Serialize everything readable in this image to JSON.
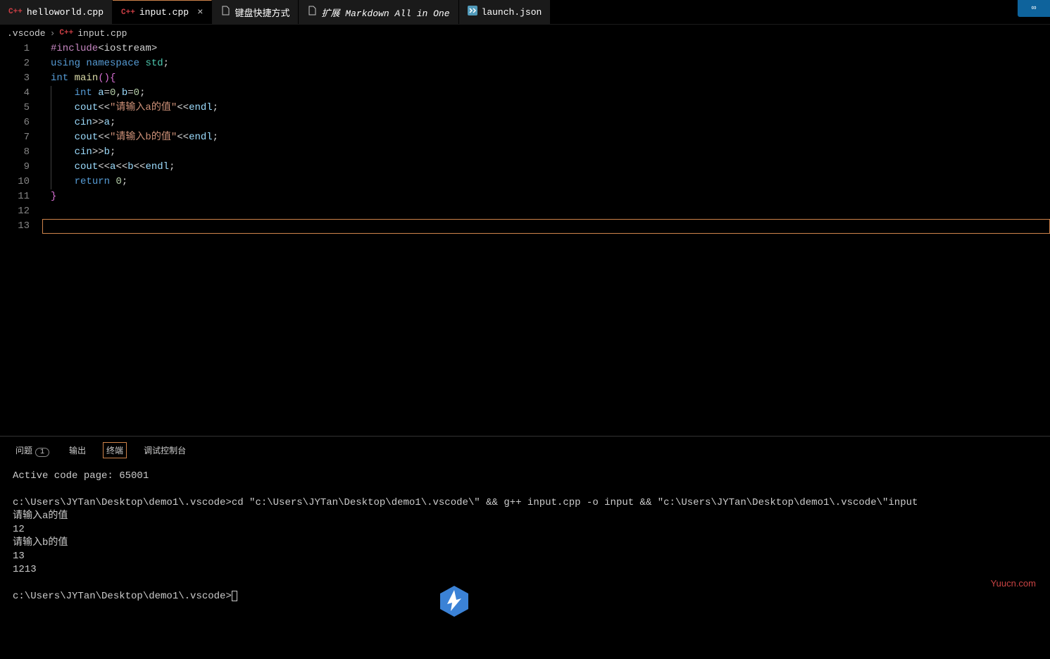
{
  "tabs": [
    {
      "label": "helloworld.cpp",
      "icon": "cpp",
      "active": false,
      "italic": false
    },
    {
      "label": "input.cpp",
      "icon": "cpp",
      "active": true,
      "italic": false,
      "closeable": true
    },
    {
      "label": "键盘快捷方式",
      "icon": "file",
      "active": false,
      "italic": false
    },
    {
      "label": "扩展 Markdown All in One",
      "icon": "file",
      "active": false,
      "italic": true
    },
    {
      "label": "launch.json",
      "icon": "json",
      "active": false,
      "italic": false
    }
  ],
  "breadcrumb": {
    "parts": [
      ".vscode",
      "input.cpp"
    ],
    "icon_label": "C++"
  },
  "code": {
    "lines": [
      [
        {
          "t": "preproc",
          "v": "#include"
        },
        {
          "t": "default",
          "v": "<iostream>"
        }
      ],
      [
        {
          "t": "keyword",
          "v": "using"
        },
        {
          "t": "default",
          "v": " "
        },
        {
          "t": "keyword",
          "v": "namespace"
        },
        {
          "t": "default",
          "v": " "
        },
        {
          "t": "namespace",
          "v": "std"
        },
        {
          "t": "default",
          "v": ";"
        }
      ],
      [
        {
          "t": "type",
          "v": "int"
        },
        {
          "t": "default",
          "v": " "
        },
        {
          "t": "func",
          "v": "main"
        },
        {
          "t": "brace",
          "v": "()"
        },
        {
          "t": "brace",
          "v": "{"
        }
      ],
      [
        {
          "t": "default",
          "v": "    "
        },
        {
          "t": "type",
          "v": "int"
        },
        {
          "t": "default",
          "v": " "
        },
        {
          "t": "ident",
          "v": "a"
        },
        {
          "t": "default",
          "v": "="
        },
        {
          "t": "number",
          "v": "0"
        },
        {
          "t": "default",
          "v": ","
        },
        {
          "t": "ident",
          "v": "b"
        },
        {
          "t": "default",
          "v": "="
        },
        {
          "t": "number",
          "v": "0"
        },
        {
          "t": "default",
          "v": ";"
        }
      ],
      [
        {
          "t": "default",
          "v": "    "
        },
        {
          "t": "ident",
          "v": "cout"
        },
        {
          "t": "default",
          "v": "<<"
        },
        {
          "t": "string",
          "v": "\"请输入a的值\""
        },
        {
          "t": "default",
          "v": "<<"
        },
        {
          "t": "ident",
          "v": "endl"
        },
        {
          "t": "default",
          "v": ";"
        }
      ],
      [
        {
          "t": "default",
          "v": "    "
        },
        {
          "t": "ident",
          "v": "cin"
        },
        {
          "t": "default",
          "v": ">>"
        },
        {
          "t": "ident",
          "v": "a"
        },
        {
          "t": "default",
          "v": ";"
        }
      ],
      [
        {
          "t": "default",
          "v": "    "
        },
        {
          "t": "ident",
          "v": "cout"
        },
        {
          "t": "default",
          "v": "<<"
        },
        {
          "t": "string",
          "v": "\"请输入b的值\""
        },
        {
          "t": "default",
          "v": "<<"
        },
        {
          "t": "ident",
          "v": "endl"
        },
        {
          "t": "default",
          "v": ";"
        }
      ],
      [
        {
          "t": "default",
          "v": "    "
        },
        {
          "t": "ident",
          "v": "cin"
        },
        {
          "t": "default",
          "v": ">>"
        },
        {
          "t": "ident",
          "v": "b"
        },
        {
          "t": "default",
          "v": ";"
        }
      ],
      [
        {
          "t": "default",
          "v": "    "
        },
        {
          "t": "ident",
          "v": "cout"
        },
        {
          "t": "default",
          "v": "<<"
        },
        {
          "t": "ident",
          "v": "a"
        },
        {
          "t": "default",
          "v": "<<"
        },
        {
          "t": "ident",
          "v": "b"
        },
        {
          "t": "default",
          "v": "<<"
        },
        {
          "t": "ident",
          "v": "endl"
        },
        {
          "t": "default",
          "v": ";"
        }
      ],
      [
        {
          "t": "default",
          "v": "    "
        },
        {
          "t": "keyword",
          "v": "return"
        },
        {
          "t": "default",
          "v": " "
        },
        {
          "t": "number",
          "v": "0"
        },
        {
          "t": "default",
          "v": ";"
        }
      ],
      [
        {
          "t": "brace",
          "v": "}"
        }
      ],
      [],
      []
    ],
    "cursor_line": 13
  },
  "panel": {
    "tabs": [
      {
        "label": "问题",
        "badge": "1"
      },
      {
        "label": "输出"
      },
      {
        "label": "终端",
        "active": true
      },
      {
        "label": "调试控制台"
      }
    ]
  },
  "terminal": {
    "lines": [
      "Active code page: 65001",
      "",
      "c:\\Users\\JYTan\\Desktop\\demo1\\.vscode>cd \"c:\\Users\\JYTan\\Desktop\\demo1\\.vscode\\\" && g++ input.cpp -o input && \"c:\\Users\\JYTan\\Desktop\\demo1\\.vscode\\\"input",
      "请输入a的值",
      "12",
      "请输入b的值",
      "13",
      "1213",
      "",
      "c:\\Users\\JYTan\\Desktop\\demo1\\.vscode>"
    ]
  },
  "watermark": "Yuucn.com",
  "top_right_badge": "∞"
}
